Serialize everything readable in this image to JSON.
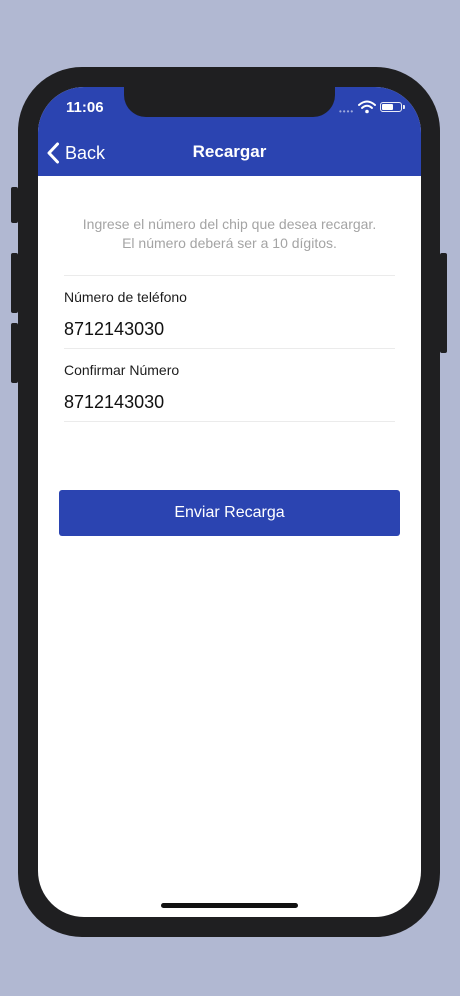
{
  "status_bar": {
    "time": "11:06",
    "signal_icon": "signal-dots-icon",
    "wifi_icon": "wifi-icon",
    "battery_icon": "battery-icon",
    "battery_level": 0.55
  },
  "nav": {
    "back_label": "Back",
    "back_icon": "chevron-left-icon",
    "title": "Recargar"
  },
  "form": {
    "instructions_line1": "Ingrese el número del chip que desea recargar.",
    "instructions_line2": "El número deberá ser a 10 dígitos.",
    "phone_label": "Número de teléfono",
    "phone_value": "8712143030",
    "confirm_label": "Confirmar Número",
    "confirm_value": "8712143030",
    "submit_label": "Enviar Recarga"
  },
  "colors": {
    "primary": "#2b44b1",
    "background": "#b1b8d2",
    "device": "#1f1f21",
    "hint_text": "#a4a4a4"
  }
}
